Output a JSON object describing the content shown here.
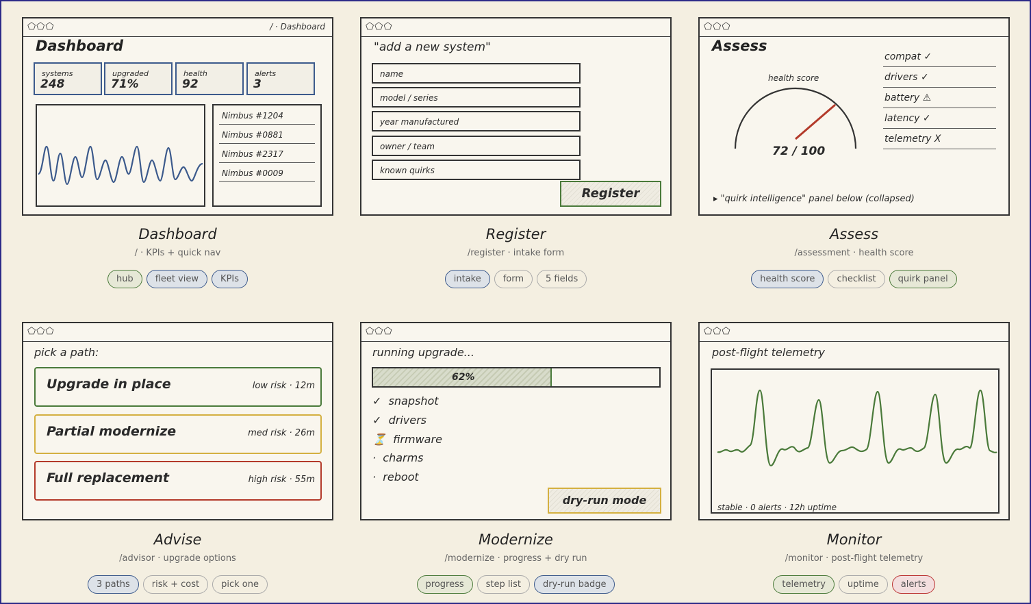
{
  "colors": {
    "green": "#4a7a3a",
    "blue": "#3c5a8c",
    "red": "#b33a2a",
    "yellow": "#d4b040",
    "ink": "#333333"
  },
  "window_icons": "⬠⬠⬠",
  "cards": {
    "dashboard": {
      "crumb": "/ · Dashboard",
      "title": "Dashboard",
      "kpis": [
        {
          "label": "systems",
          "value": "248"
        },
        {
          "label": "upgraded",
          "value": "71%"
        },
        {
          "label": "health",
          "value": "92"
        },
        {
          "label": "alerts",
          "value": "3"
        }
      ],
      "systems": [
        "Nimbus #1204",
        "Nimbus #0881",
        "Nimbus #2317",
        "Nimbus #0009"
      ],
      "caption": "Dashboard",
      "sub": "/ · KPIs + quick nav",
      "tags": [
        {
          "text": "hub",
          "style": "g"
        },
        {
          "text": "fleet view",
          "style": "b"
        },
        {
          "text": "KPIs",
          "style": "b"
        }
      ]
    },
    "register": {
      "title": "\"add a new system\"",
      "fields": [
        "name",
        "model / series",
        "year manufactured",
        "owner / team",
        "known quirks"
      ],
      "button": "Register",
      "caption": "Register",
      "sub": "/register · intake form",
      "tags": [
        {
          "text": "intake",
          "style": "b"
        },
        {
          "text": "form",
          "style": "n"
        },
        {
          "text": "5 fields",
          "style": "n"
        }
      ]
    },
    "assess": {
      "title": "Assess",
      "gauge_label": "health score",
      "score": "72 / 100",
      "score_value": 72,
      "checks": [
        {
          "label": "compat",
          "mark": "✓"
        },
        {
          "label": "drivers",
          "mark": "✓"
        },
        {
          "label": "battery",
          "mark": "⚠"
        },
        {
          "label": "latency",
          "mark": "✓"
        },
        {
          "label": "telemetry",
          "mark": "X"
        }
      ],
      "collapsed": "▸ \"quirk intelligence\" panel below (collapsed)",
      "caption": "Assess",
      "sub": "/assessment · health score",
      "tags": [
        {
          "text": "health score",
          "style": "b"
        },
        {
          "text": "checklist",
          "style": "n"
        },
        {
          "text": "quirk panel",
          "style": "g"
        }
      ]
    },
    "advise": {
      "title": "pick a path:",
      "options": [
        {
          "name": "Upgrade in place",
          "meta": "low risk · 12m",
          "color": "green"
        },
        {
          "name": "Partial modernize",
          "meta": "med risk · 26m",
          "color": "yellow"
        },
        {
          "name": "Full replacement",
          "meta": "high risk · 55m",
          "color": "red"
        }
      ],
      "caption": "Advise",
      "sub": "/advisor · upgrade options",
      "tags": [
        {
          "text": "3 paths",
          "style": "b"
        },
        {
          "text": "risk + cost",
          "style": "n"
        },
        {
          "text": "pick one",
          "style": "n"
        }
      ]
    },
    "modernize": {
      "title": "running upgrade...",
      "progress_label": "62%",
      "progress": 0.62,
      "steps": [
        {
          "mark": "✓",
          "label": "snapshot"
        },
        {
          "mark": "✓",
          "label": "drivers"
        },
        {
          "mark": "⏳",
          "label": "firmware"
        },
        {
          "mark": "·",
          "label": "charms"
        },
        {
          "mark": "·",
          "label": "reboot"
        }
      ],
      "badge": "dry-run mode",
      "caption": "Modernize",
      "sub": "/modernize · progress + dry run",
      "tags": [
        {
          "text": "progress",
          "style": "g"
        },
        {
          "text": "step list",
          "style": "n"
        },
        {
          "text": "dry-run badge",
          "style": "b"
        }
      ]
    },
    "monitor": {
      "title": "post-flight telemetry",
      "footer": "stable · 0 alerts · 12h uptime",
      "caption": "Monitor",
      "sub": "/monitor · post-flight telemetry",
      "tags": [
        {
          "text": "telemetry",
          "style": "g"
        },
        {
          "text": "uptime",
          "style": "n"
        },
        {
          "text": "alerts",
          "style": "r"
        }
      ]
    }
  }
}
